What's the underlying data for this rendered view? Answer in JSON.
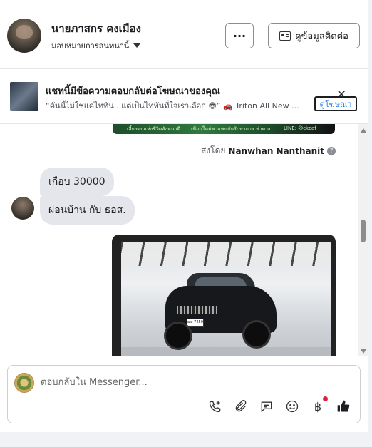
{
  "header": {
    "name": "นายภาสกร คงเมือง",
    "assignee": "มอบหมายการสนทนานี้",
    "more_label": "···",
    "contact_label": "ดูข้อมูลติดต่อ"
  },
  "ad_banner": {
    "title": "แชทนี้มีข้อความตอบกลับต่อโฆษณาของคุณ",
    "text": "“คันนี้ไม่ใช่แค่ไททัน...แต่เป็นไททันที่ใจเราเลือก 😎” 🚗 Triton All New ...",
    "view_label": "ดูโฆษณา",
    "close_label": "✕"
  },
  "messages": {
    "prev_image_text": [
      "เลี้ยงตนแห่งชีวิตสังหนาดี",
      "เพื่อนใหม่พาแพนกันรักษาการ ท่าทาง",
      "LINE: @ckcaf"
    ],
    "sent_by_prefix": "ส่งโดย",
    "sent_by_name": "Nanwhan Nanthanit",
    "help": "?",
    "bubble_1": "เกือบ 30000",
    "bubble_2": "ผ่อนบ้าน กับ ธอส.",
    "plate": "ฌม 7450"
  },
  "composer": {
    "placeholder": "ตอบกลับใน Messenger..."
  },
  "icons": {
    "call": "phone-plus-icon",
    "attach": "paperclip-icon",
    "saved_reply": "chat-bubble-icon",
    "emoji": "smiley-icon",
    "payment": "baht-icon",
    "like": "thumbs-up-icon"
  },
  "colors": {
    "accent": "#1877f2",
    "bubble": "#e4e6eb",
    "notify_dot": "#e41e3f"
  }
}
